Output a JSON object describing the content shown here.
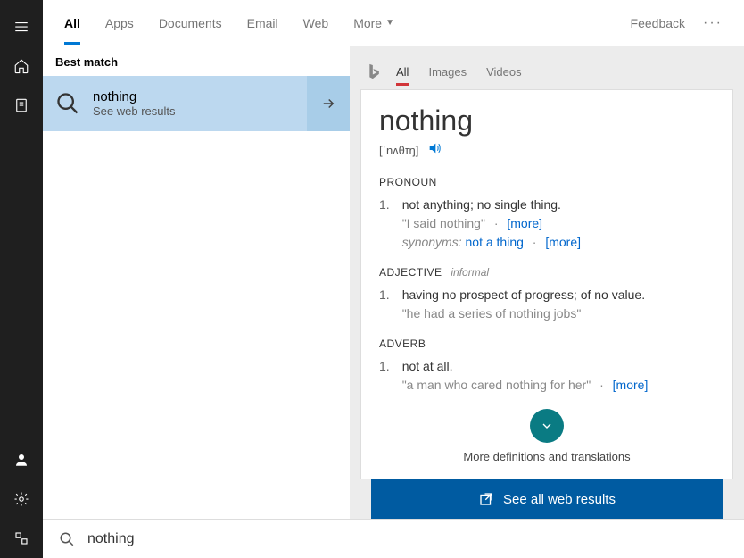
{
  "tabs": {
    "items": [
      "All",
      "Apps",
      "Documents",
      "Email",
      "Web",
      "More"
    ],
    "active": "All",
    "feedback": "Feedback"
  },
  "left": {
    "best_match": "Best match",
    "result_title": "nothing",
    "result_sub": "See web results"
  },
  "bing_tabs": [
    "All",
    "Images",
    "Videos"
  ],
  "dict": {
    "word": "nothing",
    "pron": "[ˈnʌθɪŋ]",
    "sections": [
      {
        "pos": "PRONOUN",
        "tag": "",
        "def": "not anything; no single thing.",
        "example": "\"I said nothing\"",
        "more1": "[more]",
        "syn_label": "synonyms:",
        "syn": "not a thing",
        "more2": "[more]"
      },
      {
        "pos": "ADJECTIVE",
        "tag": "informal",
        "def": "having no prospect of progress; of no value.",
        "example": "\"he had a series of nothing jobs\""
      },
      {
        "pos": "ADVERB",
        "tag": "",
        "def": "not at all.",
        "example": "\"a man who cared nothing for her\"",
        "more1": "[more]"
      }
    ],
    "more_defs": "More definitions and translations",
    "see_all": "See all web results"
  },
  "search": {
    "value": "nothing"
  }
}
